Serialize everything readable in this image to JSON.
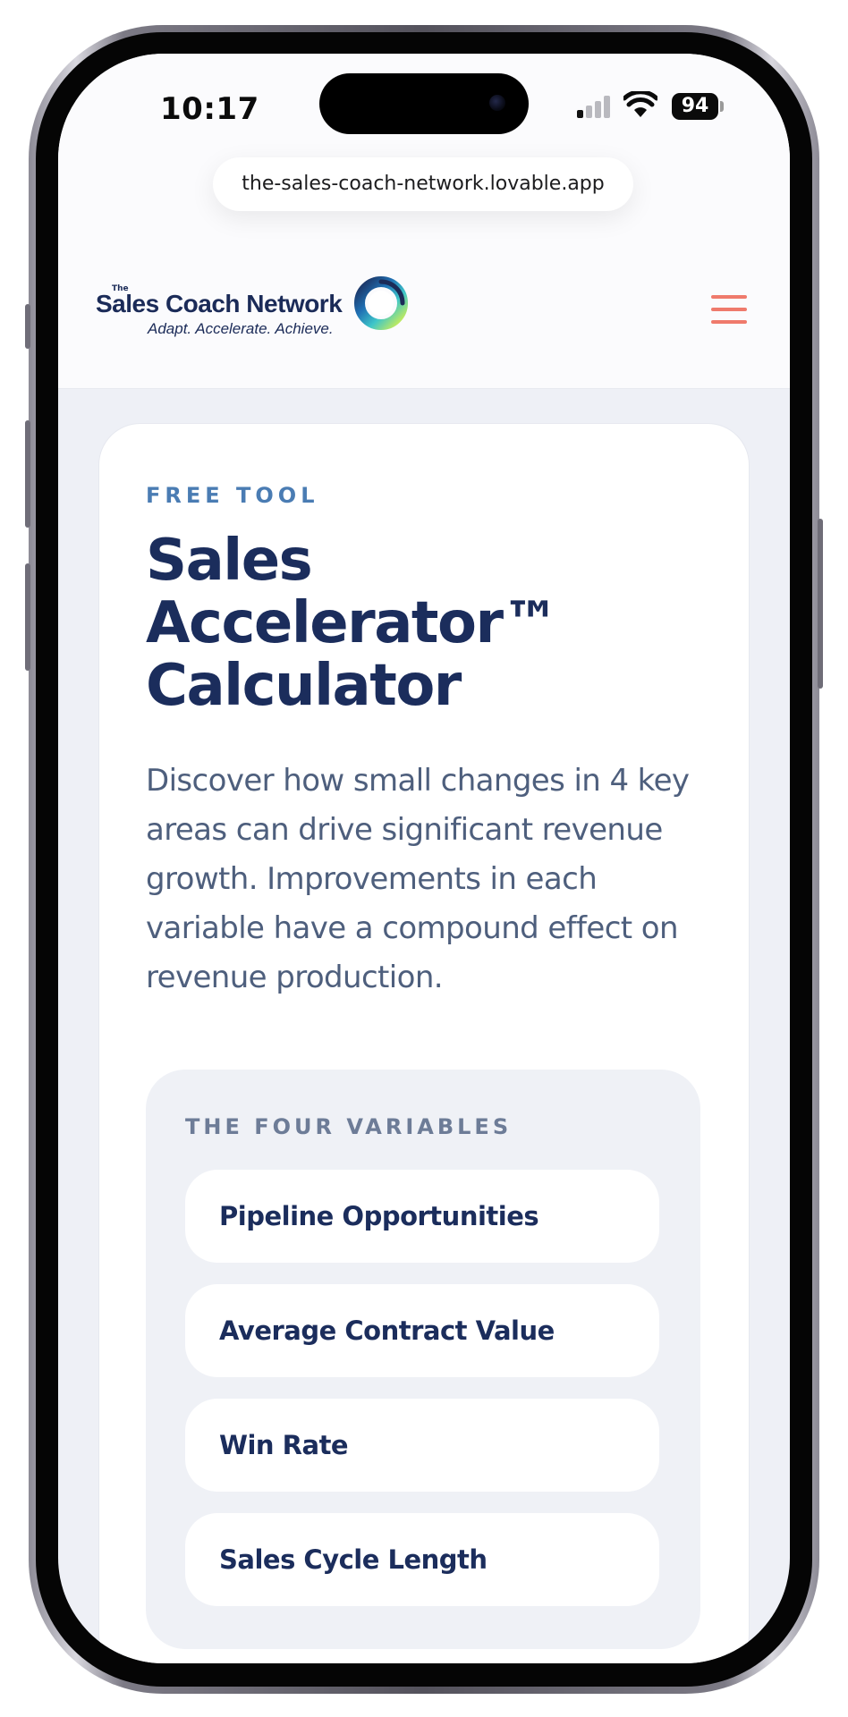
{
  "status_bar": {
    "time": "10:17",
    "battery": "94",
    "signal_icon": "cellular-signal-icon",
    "wifi_icon": "wifi-icon"
  },
  "browser": {
    "url": "the-sales-coach-network.lovable.app"
  },
  "header": {
    "logo": {
      "small_the": "The",
      "name": "Sales Coach Network",
      "tagline": "Adapt. Accelerate. Achieve."
    },
    "menu_icon": "hamburger-menu-icon"
  },
  "hero": {
    "eyebrow": "FREE TOOL",
    "title_lines": [
      "Sales",
      "Accelerator™",
      "Calculator"
    ],
    "description": "Discover how small changes in 4 key areas can drive significant revenue growth. Improvements in each variable have a compound effect on revenue production."
  },
  "variables": {
    "heading": "THE FOUR VARIABLES",
    "items": [
      {
        "label": "Pipeline Opportunities"
      },
      {
        "label": "Average Contract Value"
      },
      {
        "label": "Win Rate"
      },
      {
        "label": "Sales Cycle Length"
      }
    ]
  },
  "colors": {
    "primary_navy": "#1b2d5c",
    "eyebrow_blue": "#4a7cb3",
    "menu_coral": "#ef7a6c",
    "body_text": "#4e5f7d",
    "page_bg": "#eef0f6"
  }
}
